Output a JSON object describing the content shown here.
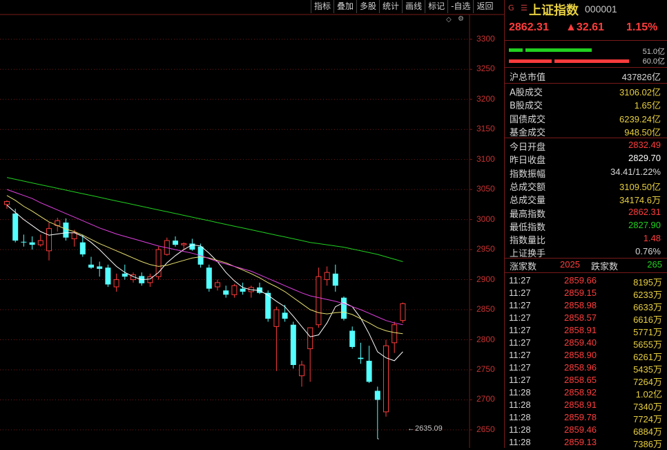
{
  "toolbar": {
    "buttons": [
      "指标",
      "叠加",
      "多股",
      "统计",
      "画线",
      "标记",
      "-自选",
      "返回"
    ],
    "diamond_icon": "diamond-icon",
    "gear_icon": "settings-icon"
  },
  "colors": {
    "up": "#ff3c3c",
    "down": "#54ffff",
    "ma_short": "#ffffff",
    "ma_mid": "#e8e070",
    "ma_long": "#e040e0",
    "ma_longest": "#20d020",
    "grid": "#7a1a1a"
  },
  "chart_data": {
    "type": "candlestick",
    "ylim": [
      2620,
      3340
    ],
    "y_ticks": [
      2650,
      2700,
      2750,
      2800,
      2850,
      2900,
      2950,
      3000,
      3050,
      3100,
      3150,
      3200,
      3250,
      3300
    ],
    "low_marker": "2635.09",
    "candles": [
      {
        "o": 3025,
        "h": 3032,
        "l": 3018,
        "c": 3030
      },
      {
        "o": 3010,
        "h": 3018,
        "l": 2962,
        "c": 2965
      },
      {
        "o": 2963,
        "h": 2975,
        "l": 2955,
        "c": 2962
      },
      {
        "o": 2962,
        "h": 2972,
        "l": 2950,
        "c": 2958
      },
      {
        "o": 2958,
        "h": 2975,
        "l": 2955,
        "c": 2965
      },
      {
        "o": 2948,
        "h": 2995,
        "l": 2932,
        "c": 2985
      },
      {
        "o": 2990,
        "h": 3003,
        "l": 2980,
        "c": 2998
      },
      {
        "o": 2995,
        "h": 3002,
        "l": 2965,
        "c": 2970
      },
      {
        "o": 2968,
        "h": 2983,
        "l": 2955,
        "c": 2978
      },
      {
        "o": 2962,
        "h": 2975,
        "l": 2938,
        "c": 2942
      },
      {
        "o": 2925,
        "h": 2938,
        "l": 2918,
        "c": 2920
      },
      {
        "o": 2922,
        "h": 2930,
        "l": 2905,
        "c": 2918
      },
      {
        "o": 2920,
        "h": 2925,
        "l": 2888,
        "c": 2892
      },
      {
        "o": 2888,
        "h": 2910,
        "l": 2880,
        "c": 2900
      },
      {
        "o": 2910,
        "h": 2925,
        "l": 2900,
        "c": 2905
      },
      {
        "o": 2900,
        "h": 2912,
        "l": 2895,
        "c": 2908
      },
      {
        "o": 2906,
        "h": 2912,
        "l": 2890,
        "c": 2894
      },
      {
        "o": 2895,
        "h": 2910,
        "l": 2888,
        "c": 2905
      },
      {
        "o": 2905,
        "h": 2955,
        "l": 2900,
        "c": 2950
      },
      {
        "o": 2942,
        "h": 2970,
        "l": 2940,
        "c": 2965
      },
      {
        "o": 2965,
        "h": 2972,
        "l": 2955,
        "c": 2958
      },
      {
        "o": 2958,
        "h": 2962,
        "l": 2950,
        "c": 2960
      },
      {
        "o": 2960,
        "h": 2968,
        "l": 2948,
        "c": 2950
      },
      {
        "o": 2955,
        "h": 2960,
        "l": 2920,
        "c": 2925
      },
      {
        "o": 2920,
        "h": 2925,
        "l": 2880,
        "c": 2885
      },
      {
        "o": 2888,
        "h": 2900,
        "l": 2882,
        "c": 2895
      },
      {
        "o": 2882,
        "h": 2890,
        "l": 2870,
        "c": 2875
      },
      {
        "o": 2875,
        "h": 2893,
        "l": 2870,
        "c": 2890
      },
      {
        "o": 2885,
        "h": 2895,
        "l": 2875,
        "c": 2880
      },
      {
        "o": 2880,
        "h": 2890,
        "l": 2870,
        "c": 2887
      },
      {
        "o": 2887,
        "h": 2895,
        "l": 2876,
        "c": 2878
      },
      {
        "o": 2878,
        "h": 2882,
        "l": 2830,
        "c": 2835
      },
      {
        "o": 2822,
        "h": 2855,
        "l": 2748,
        "c": 2850
      },
      {
        "o": 2845,
        "h": 2858,
        "l": 2830,
        "c": 2835
      },
      {
        "o": 2825,
        "h": 2830,
        "l": 2752,
        "c": 2758
      },
      {
        "o": 2740,
        "h": 2765,
        "l": 2722,
        "c": 2758
      },
      {
        "o": 2785,
        "h": 2800,
        "l": 2730,
        "c": 2820
      },
      {
        "o": 2825,
        "h": 2920,
        "l": 2820,
        "c": 2905
      },
      {
        "o": 2900,
        "h": 2922,
        "l": 2890,
        "c": 2912
      },
      {
        "o": 2910,
        "h": 2925,
        "l": 2880,
        "c": 2890
      },
      {
        "o": 2870,
        "h": 2872,
        "l": 2832,
        "c": 2835
      },
      {
        "o": 2815,
        "h": 2822,
        "l": 2785,
        "c": 2788
      },
      {
        "o": 2770,
        "h": 2795,
        "l": 2760,
        "c": 2768
      },
      {
        "o": 2765,
        "h": 2790,
        "l": 2728,
        "c": 2730
      },
      {
        "o": 2715,
        "h": 2722,
        "l": 2635,
        "c": 2700
      },
      {
        "o": 2680,
        "h": 2800,
        "l": 2672,
        "c": 2790
      },
      {
        "o": 2795,
        "h": 2830,
        "l": 2778,
        "c": 2825
      },
      {
        "o": 2832,
        "h": 2862,
        "l": 2828,
        "c": 2860
      }
    ],
    "ma_lines": [
      {
        "name": "MA5",
        "values": [
          3024,
          3012,
          3000,
          2990,
          2980,
          2974,
          2976,
          2978,
          2978,
          2972,
          2962,
          2950,
          2936,
          2922,
          2912,
          2905,
          2900,
          2901,
          2912,
          2928,
          2940,
          2950,
          2958,
          2956,
          2944,
          2930,
          2912,
          2898,
          2887,
          2883,
          2882,
          2874,
          2864,
          2855,
          2839,
          2822,
          2805,
          2808,
          2828,
          2855,
          2862,
          2855,
          2836,
          2810,
          2780,
          2770,
          2765,
          2780
        ]
      },
      {
        "name": "MA10",
        "values": [
          3040,
          3032,
          3022,
          3014,
          3005,
          2996,
          2990,
          2984,
          2980,
          2974,
          2967,
          2960,
          2954,
          2948,
          2942,
          2936,
          2930,
          2925,
          2922,
          2924,
          2928,
          2932,
          2936,
          2938,
          2936,
          2932,
          2928,
          2922,
          2916,
          2910,
          2903,
          2895,
          2888,
          2880,
          2870,
          2860,
          2850,
          2845,
          2843,
          2845,
          2846,
          2842,
          2835,
          2828,
          2820,
          2815,
          2812,
          2810
        ]
      },
      {
        "name": "MA20",
        "values": [
          3050,
          3045,
          3040,
          3035,
          3028,
          3022,
          3016,
          3010,
          3004,
          2998,
          2992,
          2986,
          2981,
          2976,
          2972,
          2968,
          2964,
          2960,
          2956,
          2953,
          2950,
          2947,
          2944,
          2940,
          2935,
          2930,
          2926,
          2922,
          2918,
          2914,
          2908,
          2902,
          2896,
          2890,
          2884,
          2878,
          2873,
          2870,
          2867,
          2864,
          2860,
          2855,
          2850,
          2844,
          2838,
          2832,
          2828,
          2825
        ]
      },
      {
        "name": "MA60",
        "values": [
          3070,
          3067,
          3064,
          3061,
          3058,
          3055,
          3052,
          3049,
          3046,
          3043,
          3040,
          3037,
          3034,
          3031,
          3028,
          3025,
          3022,
          3019,
          3016,
          3013,
          3010,
          3007,
          3004,
          3001,
          2998,
          2995,
          2992,
          2989,
          2986,
          2983,
          2980,
          2977,
          2974,
          2971,
          2968,
          2965,
          2962,
          2960,
          2958,
          2956,
          2954,
          2951,
          2948,
          2945,
          2942,
          2938,
          2934,
          2930
        ]
      }
    ]
  },
  "header": {
    "icon_g": "G",
    "icon_menu": "menu-icon",
    "name": "上证指数",
    "code": "000001",
    "price": "2862.31",
    "change": "▲32.61",
    "pct": "1.15%"
  },
  "bars": [
    {
      "value": "51.0亿",
      "ratio": 0.51,
      "color": "#20d020"
    },
    {
      "value": "60.0亿",
      "ratio": 0.6,
      "color": "#ff3c3c"
    }
  ],
  "stats_group1": [
    {
      "label": "沪总市值",
      "value": "437826亿",
      "color": "#d8d8d8"
    }
  ],
  "stats_group2": [
    {
      "label": "A股成交",
      "value": "3106.02亿",
      "color": "#e8d040"
    },
    {
      "label": "B股成交",
      "value": "1.65亿",
      "color": "#e8d040"
    },
    {
      "label": "国债成交",
      "value": "6239.24亿",
      "color": "#e8d040"
    },
    {
      "label": "基金成交",
      "value": "948.50亿",
      "color": "#e8d040"
    }
  ],
  "stats_group3": [
    {
      "label": "今日开盘",
      "value": "2832.49",
      "color": "#ff3c3c"
    },
    {
      "label": "昨日收盘",
      "value": "2829.70",
      "color": "#ffffff"
    },
    {
      "label": "指数振幅",
      "value": "34.41/1.22%",
      "color": "#d8d8d8"
    },
    {
      "label": "总成交额",
      "value": "3109.50亿",
      "color": "#e8d040"
    },
    {
      "label": "总成交量",
      "value": "34174.6万",
      "color": "#e8d040"
    },
    {
      "label": "最高指数",
      "value": "2862.31",
      "color": "#ff3c3c"
    },
    {
      "label": "最低指数",
      "value": "2827.90",
      "color": "#20d020"
    },
    {
      "label": "指数量比",
      "value": "1.48",
      "color": "#ff3c3c"
    },
    {
      "label": "上证换手",
      "value": "0.76%",
      "color": "#d8d8d8"
    }
  ],
  "updown": {
    "up_label": "涨家数",
    "up_value": "2025",
    "down_label": "跌家数",
    "down_value": "265"
  },
  "ticks": [
    {
      "time": "11:27",
      "price": "2859.66",
      "vol": "8195万"
    },
    {
      "time": "11:27",
      "price": "2859.15",
      "vol": "6233万"
    },
    {
      "time": "11:27",
      "price": "2858.98",
      "vol": "6633万"
    },
    {
      "time": "11:27",
      "price": "2858.57",
      "vol": "6616万"
    },
    {
      "time": "11:27",
      "price": "2858.91",
      "vol": "5771万"
    },
    {
      "time": "11:27",
      "price": "2859.40",
      "vol": "5655万"
    },
    {
      "time": "11:27",
      "price": "2858.90",
      "vol": "6261万"
    },
    {
      "time": "11:27",
      "price": "2858.96",
      "vol": "5435万"
    },
    {
      "time": "11:27",
      "price": "2858.65",
      "vol": "7264万"
    },
    {
      "time": "11:28",
      "price": "2858.92",
      "vol": "1.02亿"
    },
    {
      "time": "11:28",
      "price": "2858.91",
      "vol": "7340万"
    },
    {
      "time": "11:28",
      "price": "2859.78",
      "vol": "7724万"
    },
    {
      "time": "11:28",
      "price": "2859.46",
      "vol": "6884万"
    },
    {
      "time": "11:28",
      "price": "2859.13",
      "vol": "7386万"
    }
  ]
}
